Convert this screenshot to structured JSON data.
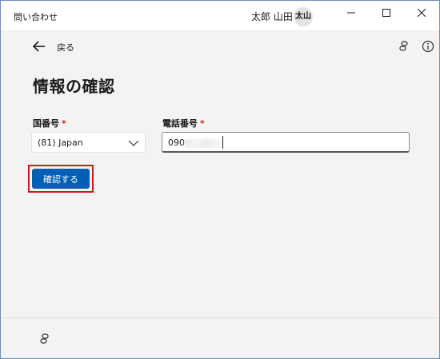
{
  "titlebar": {
    "app_title": "問い合わせ",
    "user_name": "太郎 山田",
    "avatar_initials": "太山"
  },
  "nav": {
    "back_label": "戻る"
  },
  "page": {
    "title": "情報の確認"
  },
  "form": {
    "country_label": "国番号",
    "phone_label": "電話番号",
    "required_mark": "*",
    "country_value": "(81) Japan",
    "phone_value": "090",
    "confirm_label": "確認する"
  },
  "colors": {
    "accent": "#005fb8",
    "required": "#c42b1c",
    "highlight": "#d6141c"
  },
  "icons": {
    "back": "arrow-left-icon",
    "link": "link-icon",
    "info": "info-icon",
    "chevron": "chevron-down-icon",
    "minimize": "minimize-icon",
    "maximize": "maximize-icon",
    "close": "close-icon"
  }
}
